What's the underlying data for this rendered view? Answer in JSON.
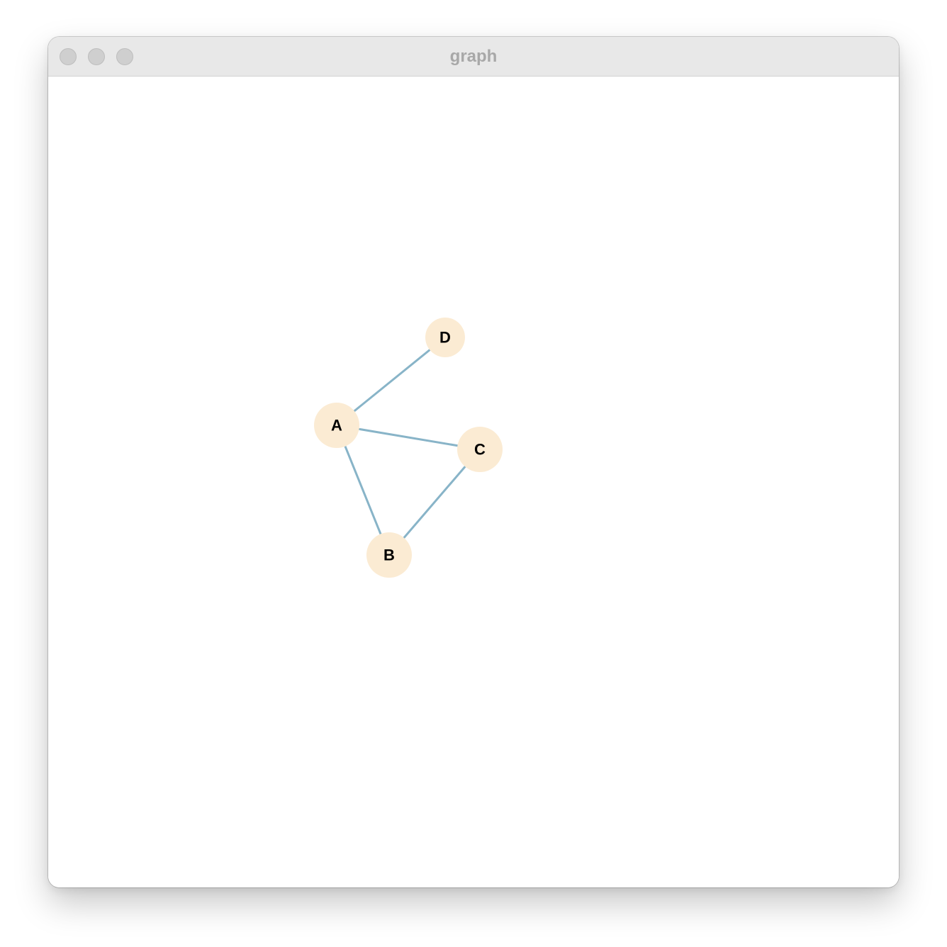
{
  "window": {
    "title": "graph"
  },
  "graph": {
    "nodes": [
      {
        "id": "A",
        "label": "A"
      },
      {
        "id": "B",
        "label": "B"
      },
      {
        "id": "C",
        "label": "C"
      },
      {
        "id": "D",
        "label": "D"
      }
    ],
    "edges": [
      {
        "source": "A",
        "target": "D"
      },
      {
        "source": "A",
        "target": "C"
      },
      {
        "source": "A",
        "target": "B"
      },
      {
        "source": "B",
        "target": "C"
      }
    ]
  },
  "colors": {
    "node_fill": "#fbebd3",
    "edge_stroke": "#88b4c8",
    "label": "#000000",
    "titlebar": "#e8e8e8",
    "title_text": "#a8a8a8"
  }
}
